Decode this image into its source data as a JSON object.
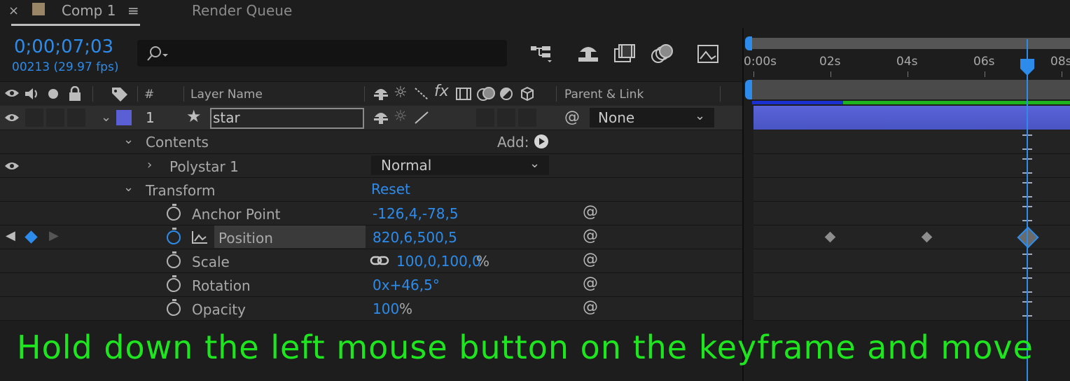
{
  "tabs": {
    "comp_tab": "Comp 1",
    "close": "×",
    "menu": "≡",
    "render_queue": "Render Queue"
  },
  "timecode": {
    "time": "0;00;07;03",
    "frames": "00213 (29.97 fps)"
  },
  "search": {
    "placeholder": ""
  },
  "columns": {
    "number": "#",
    "layer_name": "Layer Name",
    "fx": "fx",
    "parent_link": "Parent & Link"
  },
  "layer": {
    "number": "1",
    "name": "star",
    "parent": "None",
    "label_color": "#5b5fd6"
  },
  "contents": {
    "label": "Contents",
    "add_label": "Add:",
    "polystar": "Polystar 1",
    "blend_mode": "Normal"
  },
  "transform": {
    "label": "Transform",
    "reset": "Reset",
    "props": [
      {
        "name": "Anchor Point",
        "value": "-126,4,-78,5"
      },
      {
        "name": "Position",
        "value": "820,6,500,5"
      },
      {
        "name": "Scale",
        "value": "100,0,100,0",
        "suffix": "%"
      },
      {
        "name": "Rotation",
        "value": "0x+46,5°"
      },
      {
        "name": "Opacity",
        "value": "100",
        "suffix": "%"
      }
    ]
  },
  "timeline": {
    "ruler": [
      "0:00s",
      "02s",
      "04s",
      "06s",
      "08s"
    ],
    "current_time_seconds": 7.1,
    "position_keyframes_seconds": [
      2.0,
      4.5,
      7.1
    ]
  },
  "caption": "Hold down the left mouse button on the keyframe and move",
  "colors": {
    "accent": "#2d8ceb",
    "caption": "#1ee61e",
    "layer_bar": "#4a55c4",
    "work_area": "#1fb21f"
  }
}
